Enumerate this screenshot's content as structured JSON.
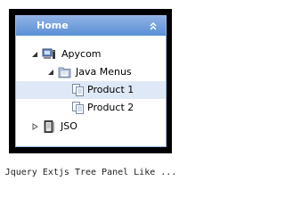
{
  "panel": {
    "title": "Home"
  },
  "tree": {
    "nodes": [
      {
        "label": "Apycom",
        "expanded": true,
        "icon": "computer-icon"
      },
      {
        "label": "Java Menus",
        "expanded": true,
        "icon": "folder-icon"
      },
      {
        "label": "Product 1",
        "selected": true,
        "icon": "documents-icon"
      },
      {
        "label": "Product 2",
        "icon": "documents-icon"
      },
      {
        "label": "JSO",
        "expanded": false,
        "icon": "book-icon"
      }
    ]
  },
  "caption": "Jquery Extjs Tree Panel Like ...",
  "colors": {
    "header": "#6f9bdc",
    "selection": "#dfe8f6",
    "border": "#99bbe8"
  }
}
